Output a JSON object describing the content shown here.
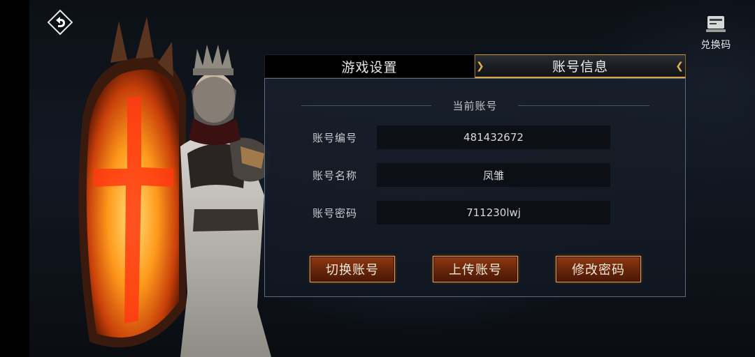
{
  "header": {
    "back_icon": "back-arrow-icon",
    "redeem": {
      "label": "兑换码",
      "icon": "card-icon"
    }
  },
  "tabs": [
    {
      "label": "游戏设置",
      "active": false
    },
    {
      "label": "账号信息",
      "active": true
    }
  ],
  "account": {
    "section_title": "当前账号",
    "fields": [
      {
        "label": "账号编号",
        "value": "481432672"
      },
      {
        "label": "账号名称",
        "value": "凤雏"
      },
      {
        "label": "账号密码",
        "value": "711230lwj"
      }
    ],
    "buttons": [
      {
        "label": "切换账号"
      },
      {
        "label": "上传账号"
      },
      {
        "label": "修改密码"
      }
    ]
  },
  "colors": {
    "accent_gold": "#d8a64a",
    "button_fill": "#6a2609",
    "panel_border": "#5d6c80"
  }
}
